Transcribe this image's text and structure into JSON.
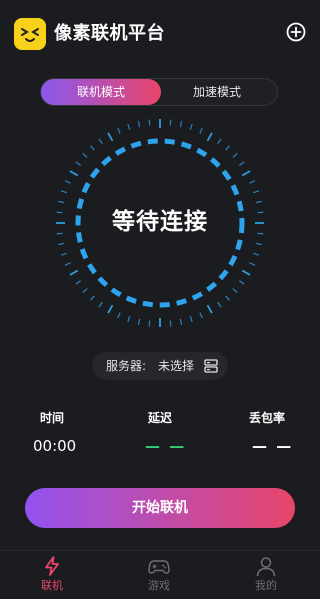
{
  "header": {
    "title": "像素联机平台",
    "logo_icon": "smiley-logo-icon",
    "add_icon": "plus-circle-icon"
  },
  "mode_tabs": [
    {
      "label": "联机模式",
      "active": true
    },
    {
      "label": "加速模式",
      "active": false
    }
  ],
  "dial": {
    "status_text": "等待连接"
  },
  "server": {
    "label": "服务器:",
    "value": "未选择",
    "icon": "server-list-icon"
  },
  "stats": {
    "time": {
      "label": "时间",
      "value": "00:00"
    },
    "latency": {
      "label": "延迟",
      "value": "— —"
    },
    "packet_loss": {
      "label": "丢包率",
      "value": "— —"
    }
  },
  "start_button": {
    "label": "开始联机"
  },
  "bottom_nav": [
    {
      "label": "联机",
      "icon": "lightning-icon",
      "active": true
    },
    {
      "label": "游戏",
      "icon": "gamepad-icon",
      "active": false
    },
    {
      "label": "我的",
      "icon": "user-icon",
      "active": false
    }
  ],
  "colors": {
    "background": "#1b1c20",
    "accent_start": "#8a58ee",
    "accent_end": "#e8466a",
    "dial_blue": "#2fa4ee",
    "active_nav": "#e8466a",
    "latency_green": "#2fcf72",
    "inactive_nav": "#6d6e73"
  }
}
